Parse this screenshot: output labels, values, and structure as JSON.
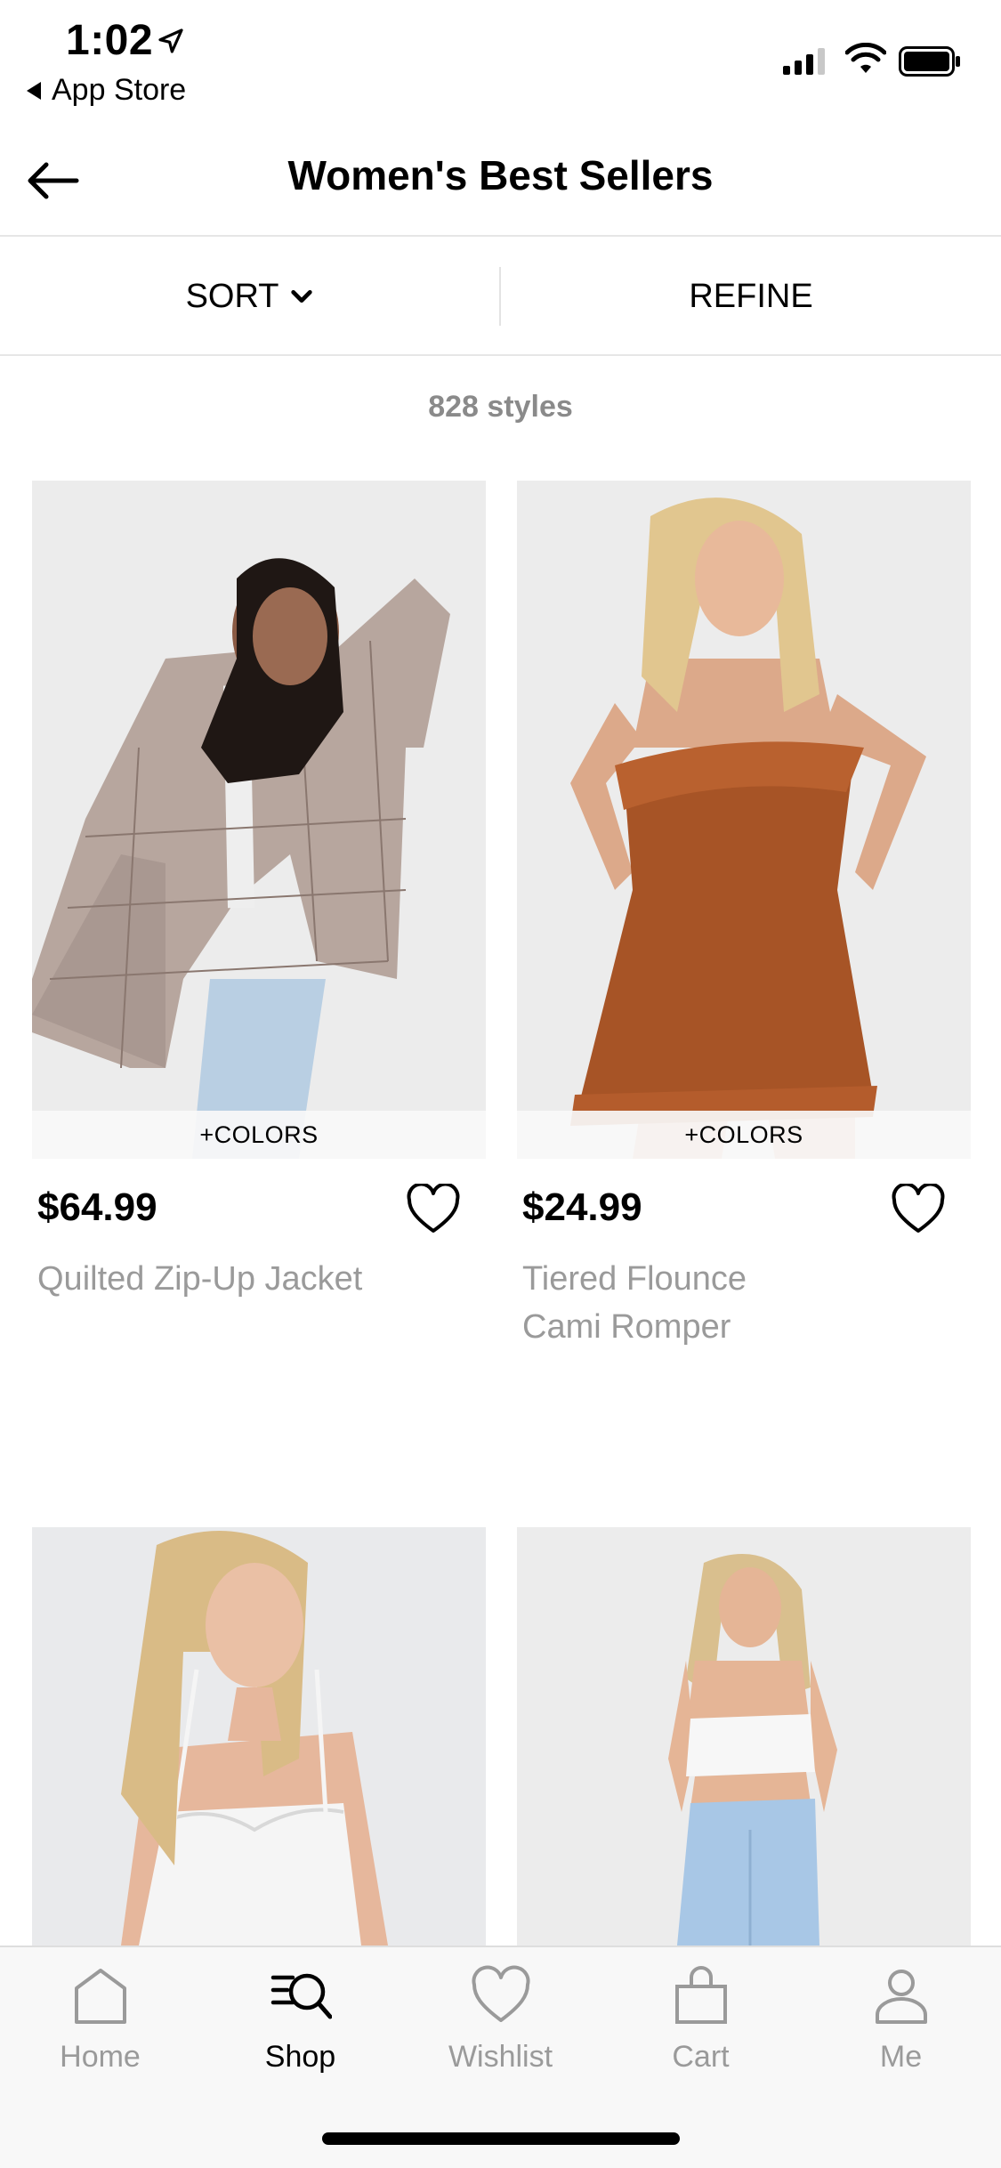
{
  "status_bar": {
    "time": "1:02",
    "back_app_label": "App Store"
  },
  "header": {
    "title": "Women's Best Sellers"
  },
  "filter_bar": {
    "sort_label": "SORT",
    "refine_label": "REFINE"
  },
  "results": {
    "count_text": "828 styles"
  },
  "products": [
    {
      "price": "$64.99",
      "name": "Quilted Zip-Up Jacket",
      "colors_badge": "+COLORS"
    },
    {
      "price": "$24.99",
      "name": "Tiered Flounce Cami Romper",
      "colors_badge": "+COLORS"
    },
    {
      "price": "",
      "name": "",
      "colors_badge": ""
    },
    {
      "price": "",
      "name": "",
      "colors_badge": ""
    }
  ],
  "tab_bar": {
    "items": [
      {
        "label": "Home",
        "icon": "home-icon",
        "active": false
      },
      {
        "label": "Shop",
        "icon": "shop-search-icon",
        "active": true
      },
      {
        "label": "Wishlist",
        "icon": "heart-icon",
        "active": false
      },
      {
        "label": "Cart",
        "icon": "bag-icon",
        "active": false
      },
      {
        "label": "Me",
        "icon": "person-icon",
        "active": false
      }
    ]
  },
  "colors": {
    "text_primary": "#000000",
    "text_secondary": "#9a9a9a",
    "divider": "#e6e6e6",
    "photo_bg": "#ebebeb"
  }
}
